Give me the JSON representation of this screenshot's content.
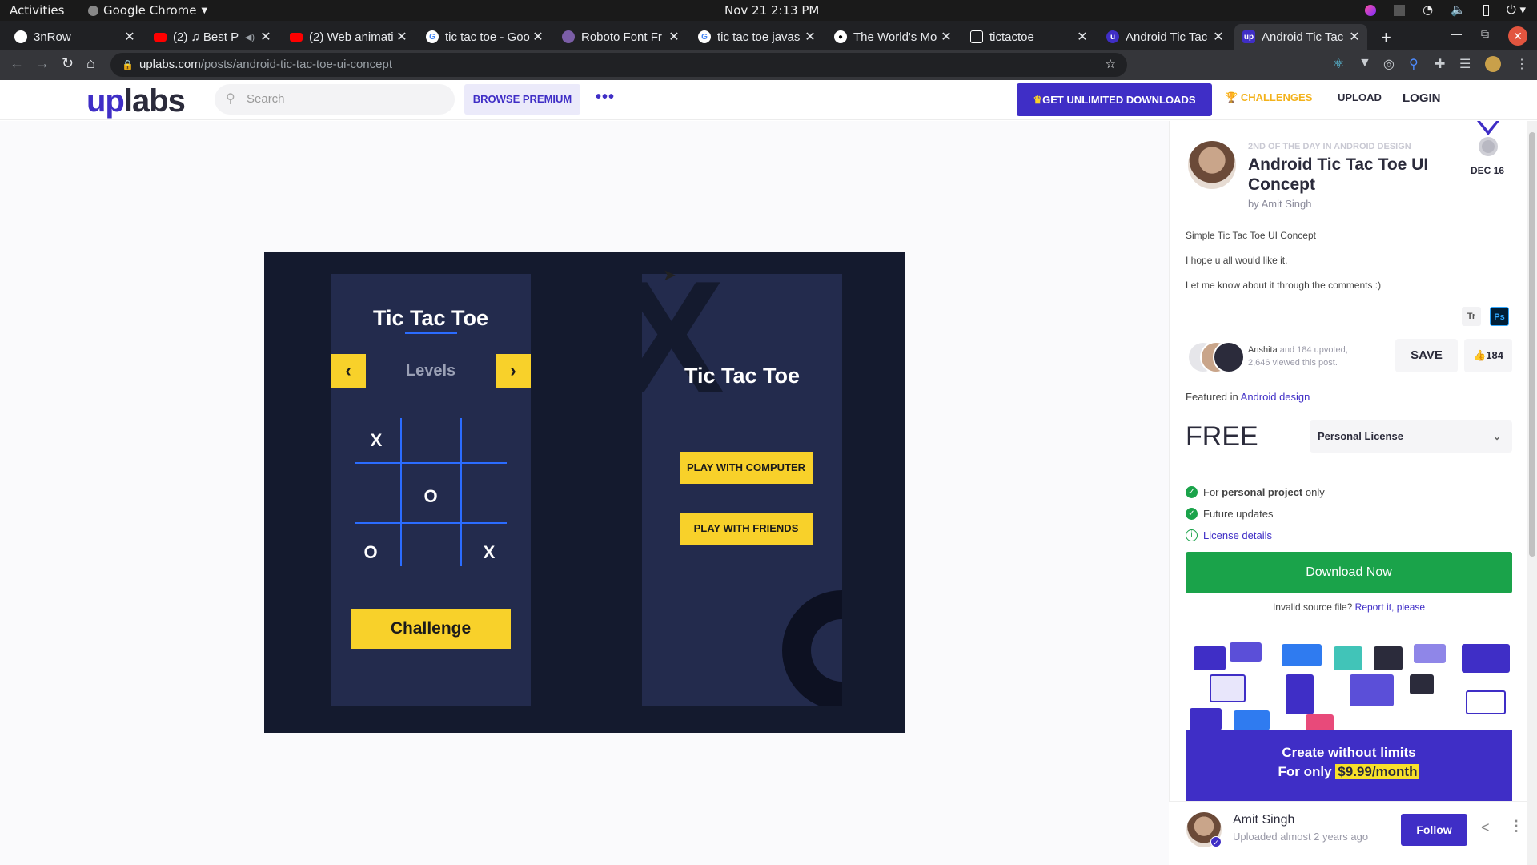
{
  "system": {
    "activities": "Activities",
    "app_name": "Google Chrome",
    "clock": "Nov 21  2:13 PM"
  },
  "tabs": [
    {
      "label": "3nRow",
      "icon": "chrome-web-icon",
      "color": "#ffffff"
    },
    {
      "label": "(2) ♫ Best P",
      "icon": "youtube-icon",
      "color": "#ff0000"
    },
    {
      "label": "(2) Web animati",
      "icon": "youtube-icon",
      "color": "#ff0000"
    },
    {
      "label": "tic tac toe - Goo",
      "icon": "google-icon",
      "color": "#4285f4"
    },
    {
      "label": "Roboto Font Fr",
      "icon": "font-icon",
      "color": "#7b5ea7"
    },
    {
      "label": "tic tac toe javas",
      "icon": "google-icon",
      "color": "#4285f4"
    },
    {
      "label": "The World's Mo",
      "icon": "medium-icon",
      "color": "#000000"
    },
    {
      "label": "tictactoe",
      "icon": "codepen-icon",
      "color": "#ffffff"
    },
    {
      "label": "Android Tic Tac",
      "icon": "uplabs-icon",
      "color": "#3f2ec6"
    },
    {
      "label": "Android Tic Tac",
      "icon": "uplabs-icon",
      "color": "#3f2ec6"
    }
  ],
  "address": {
    "host": "uplabs.com",
    "path": "/posts/android-tic-tac-toe-ui-concept"
  },
  "header": {
    "logo_up": "up",
    "logo_labs": "labs",
    "search_placeholder": "Search",
    "browse_premium": "BROWSE PREMIUM",
    "more": "•••",
    "unlimited": "GET UNLIMITED DOWNLOADS",
    "challenges": "CHALLENGES",
    "upload": "UPLOAD",
    "login": "LOGIN"
  },
  "shot": {
    "screen1": {
      "title": "Tic Tac Toe",
      "left_arrow": "‹",
      "right_arrow": "›",
      "levels": "Levels",
      "board": [
        "X",
        "",
        "",
        "",
        "O",
        "",
        "O",
        "",
        "X"
      ],
      "challenge": "Challenge"
    },
    "screen2": {
      "big_x": "X",
      "title": "Tic Tac Toe",
      "btn_computer": "PLAY WITH COMPUTER",
      "btn_friends": "PLAY WITH FRIENDS"
    }
  },
  "sidebar": {
    "award": "2ND OF THE DAY IN ANDROID DESIGN",
    "title": "Android Tic Tac Toe UI Concept",
    "byline": "by Amit Singh",
    "date": "DEC 16",
    "desc1": "Simple Tic Tac Toe UI Concept",
    "desc2": "I hope u all would like it.",
    "desc3": "Let me know about it through the comments :)",
    "tool1": "Tr",
    "tool2": "Ps",
    "upvoter_name": "Anshita",
    "upvote_text": " and 184 upvoted,",
    "views_text": "2,646 viewed this post.",
    "save": "SAVE",
    "likes": "184",
    "featured_prefix": "Featured in ",
    "featured_link": "Android design",
    "price": "FREE",
    "license": "Personal License",
    "feat1_pre": "For ",
    "feat1_bold": "personal project",
    "feat1_post": " only",
    "feat2": "Future updates",
    "feat3": "License details",
    "download": "Download Now",
    "invalid_prefix": "Invalid source file? ",
    "invalid_link": "Report it, please",
    "promo_line1": "Create without limits",
    "promo_line2_prefix": "For only ",
    "promo_price": "$9.99/month"
  },
  "author": {
    "name": "Amit Singh",
    "uploaded": "Uploaded almost 2 years ago",
    "follow": "Follow"
  },
  "colors": {
    "brand": "#3f2ec6",
    "accent_yellow": "#f8d12a",
    "success": "#1aa34a",
    "challenges": "#f3b21b"
  }
}
